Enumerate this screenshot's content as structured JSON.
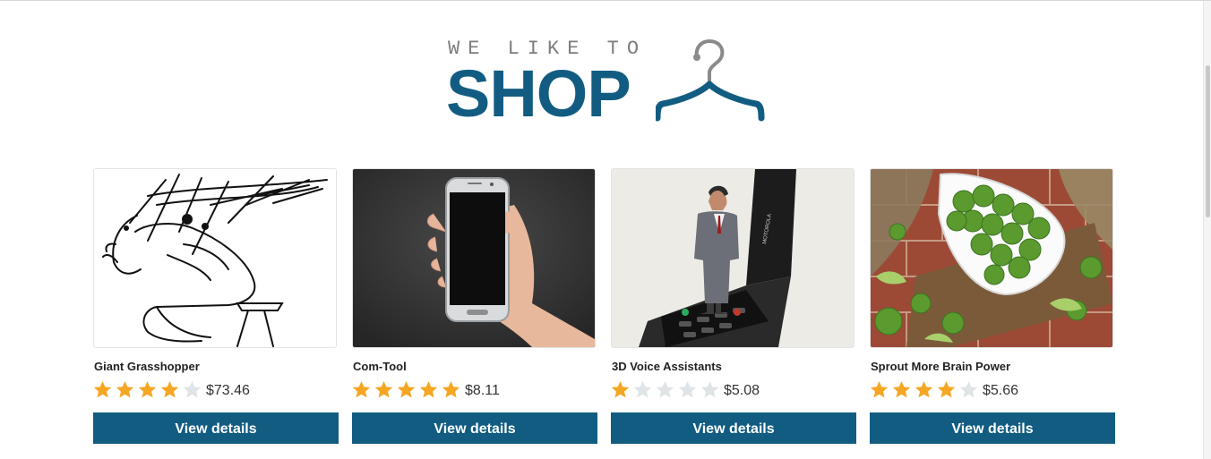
{
  "logo": {
    "small": "WE LIKE TO",
    "big": "SHOP",
    "icon": "hanger-icon"
  },
  "colors": {
    "brand": "#125c82",
    "star_filled": "#f5a623",
    "star_empty": "#dfe4e6"
  },
  "products": [
    {
      "name": "Giant Grasshopper",
      "rating": 4,
      "max_rating": 5,
      "price": "$73.46",
      "button": "View details",
      "image": "grasshopper-sketch"
    },
    {
      "name": "Com-Tool",
      "rating": 5,
      "max_rating": 5,
      "price": "$8.11",
      "button": "View details",
      "image": "hand-holding-phone"
    },
    {
      "name": "3D Voice Assistants",
      "rating": 1,
      "max_rating": 5,
      "price": "$5.08",
      "button": "View details",
      "image": "hologram-on-flip-phone"
    },
    {
      "name": "Sprout More Brain Power",
      "rating": 4,
      "max_rating": 5,
      "price": "$5.66",
      "button": "View details",
      "image": "brussels-sprouts-bowl"
    }
  ]
}
